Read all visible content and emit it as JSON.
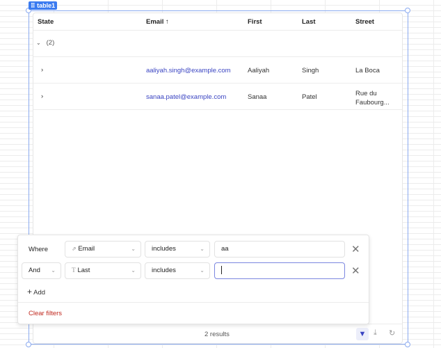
{
  "component": {
    "name": "table1"
  },
  "table": {
    "columns": [
      "State",
      "Email",
      "First",
      "Last",
      "Street"
    ],
    "sort_indicator": "↑",
    "group": {
      "label": "(2)"
    },
    "rows": [
      {
        "email": "aaliyah.singh@example.com",
        "first": "Aaliyah",
        "last": "Singh",
        "street": "La Boca"
      },
      {
        "email": "sanaa.patel@example.com",
        "first": "Sanaa",
        "last": "Patel",
        "street": "Rue du Faubourg..."
      }
    ],
    "results": "2 results"
  },
  "filters": {
    "rows": [
      {
        "conjunction": "Where",
        "column": "Email",
        "column_icon": "link-icon",
        "operator": "includes",
        "value": ""
      },
      {
        "conjunction": "And",
        "column": "Last",
        "column_icon": "text-type-icon",
        "operator": "includes",
        "value": ""
      }
    ],
    "first_value": "aa",
    "add_label": "Add",
    "clear_label": "Clear filters"
  },
  "colors": {
    "accent": "#3a44c2",
    "selection": "#8aaaf0",
    "danger": "#c0281e"
  }
}
